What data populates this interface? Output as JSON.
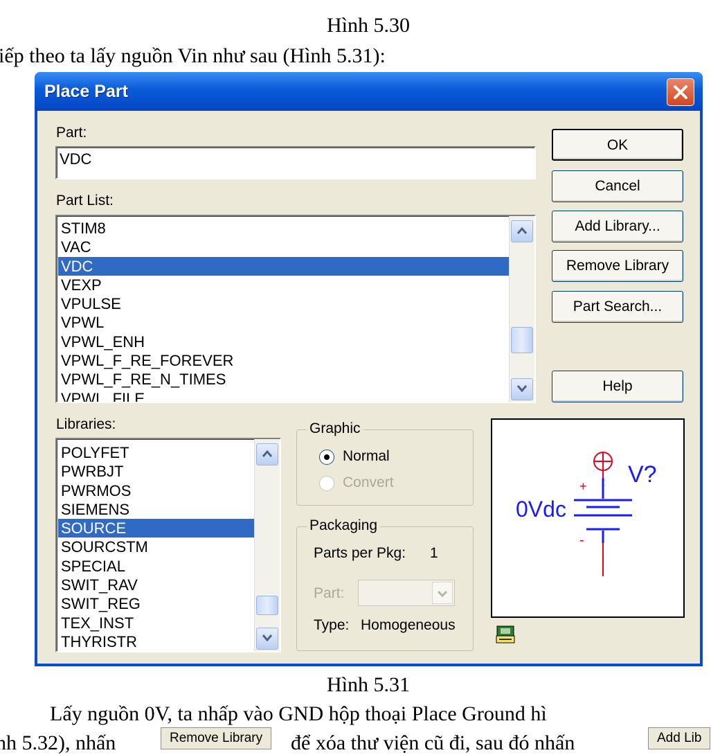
{
  "document": {
    "caption_above": "Hình 5.30",
    "intro_text": "iếp theo ta lấy nguồn Vin như sau (Hình 5.31):",
    "caption_below": "Hình 5.31",
    "body_line1": "Lấy nguồn 0V, ta nhấp vào GND hộp thoại Place Ground hì",
    "body_line2_a": "nh 5.32), nhấn",
    "body_line2_b": "để xóa thư viện cũ đi, sau đó nhấn",
    "inline_button_remove": "Remove Library",
    "inline_button_add": "Add Lib"
  },
  "dialog": {
    "title": "Place Part",
    "part_label": "Part:",
    "part_value": "VDC",
    "part_list_label": "Part List:",
    "part_list": [
      "STIM8",
      "VAC",
      "VDC",
      "VEXP",
      "VPULSE",
      "VPWL",
      "VPWL_ENH",
      "VPWL_F_RE_FOREVER",
      "VPWL_F_RE_N_TIMES",
      "VPWL_FILE"
    ],
    "part_list_selected": "VDC",
    "libraries_label": "Libraries:",
    "libraries": [
      "POLYFET",
      "PWRBJT",
      "PWRMOS",
      "SIEMENS",
      "SOURCE",
      "SOURCSTM",
      "SPECIAL",
      "SWIT_RAV",
      "SWIT_REG",
      "TEX_INST",
      "THYRISTR"
    ],
    "libraries_selected": "SOURCE",
    "buttons": {
      "ok": "OK",
      "cancel": "Cancel",
      "add_library": "Add Library...",
      "remove_library": "Remove Library",
      "part_search": "Part Search...",
      "help": "Help"
    },
    "graphic": {
      "title": "Graphic",
      "normal": "Normal",
      "convert": "Convert",
      "selected": "Normal"
    },
    "packaging": {
      "title": "Packaging",
      "parts_per_pkg_label": "Parts per Pkg:",
      "parts_per_pkg_value": "1",
      "part_label": "Part:",
      "type_label": "Type:",
      "type_value": "Homogeneous"
    },
    "preview": {
      "ref": "V?",
      "value": "0Vdc",
      "plus": "+",
      "minus": "-"
    }
  },
  "colors": {
    "title_bar": "#0a5bd8",
    "selection": "#316ac5",
    "dialog_face": "#ece9d8",
    "symbol_red": "#e8001c",
    "symbol_blue": "#1a1aff"
  }
}
